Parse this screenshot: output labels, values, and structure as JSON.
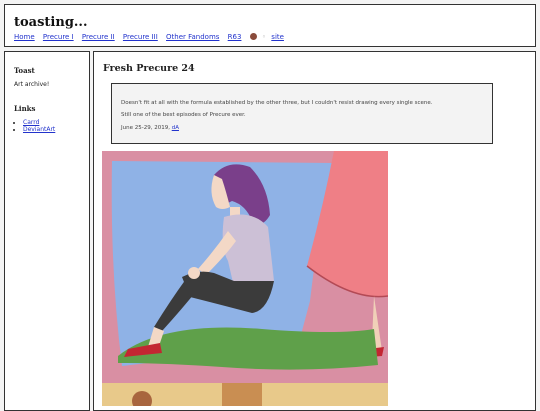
{
  "header": {
    "title": "toasting...",
    "nav": [
      "Home",
      "Precure I",
      "Precure II",
      "Precure III",
      "Other Fandoms",
      "R63"
    ],
    "site_link": "site",
    "separator": "◦"
  },
  "sidebar": {
    "toast_heading": "Toast",
    "toast_text": "Art archive!",
    "links_heading": "Links",
    "links": [
      "Carrd",
      "DeviantArt"
    ]
  },
  "post": {
    "title": "Fresh Precure 24",
    "note_line1": "Doesn't fit at all with the formula established by the other three, but I couldn't resist drawing every single scene.",
    "note_line2": "Still one of the best episodes of Precure ever.",
    "date": "June 25-29, 2019,",
    "date_link": "dA"
  },
  "colors": {
    "link": "#2233cc",
    "border": "#333333",
    "note_bg": "#f3f3f3"
  }
}
